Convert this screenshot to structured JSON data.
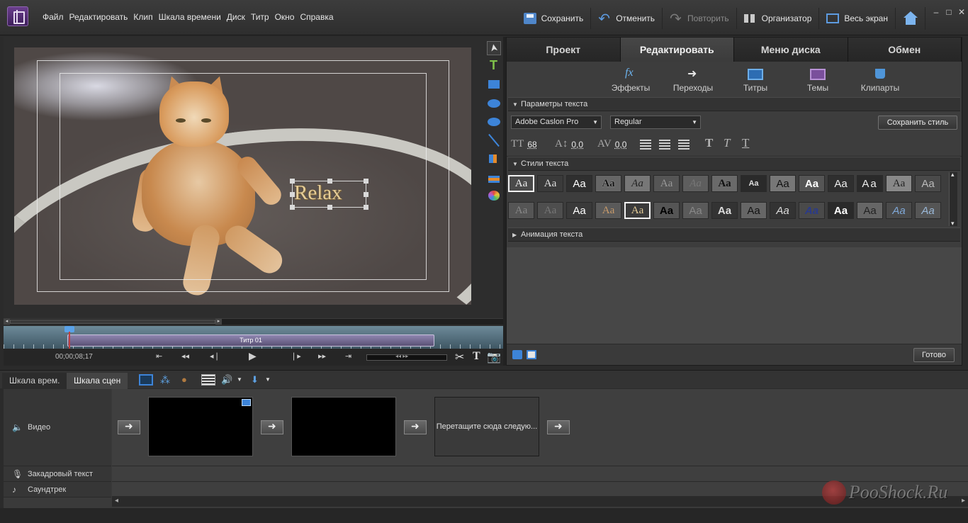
{
  "menu": [
    "Файл",
    "Редактировать",
    "Клип",
    "Шкала времени",
    "Диск",
    "Титр",
    "Окно",
    "Справка"
  ],
  "toolbar": {
    "save": "Сохранить",
    "undo": "Отменить",
    "redo": "Повторить",
    "organizer": "Организатор",
    "fullscreen": "Весь экран"
  },
  "window_controls": [
    "–",
    "□",
    "✕"
  ],
  "monitor": {
    "title_text": "Relax",
    "clip_label": "Титр 01",
    "timecode": "00;00;08;17"
  },
  "panel": {
    "tabs": [
      "Проект",
      "Редактировать",
      "Меню диска",
      "Обмен"
    ],
    "active_tab": "Редактировать",
    "sub_tabs": [
      "Эффекты",
      "Переходы",
      "Титры",
      "Темы",
      "Клипарты"
    ],
    "sections": {
      "text_params": "Параметры текста",
      "text_styles": "Стили текста",
      "text_animation": "Анимация текста"
    },
    "font_family": "Adobe Caslon Pro",
    "font_style": "Regular",
    "save_style": "Сохранить стиль",
    "font_size": "68",
    "leading": "0,0",
    "kerning": "0,0",
    "style_sample": "Aa",
    "done": "Готово"
  },
  "timeline": {
    "tabs": [
      "Шкала врем.",
      "Шкала сцен"
    ],
    "active_tab": "Шкала сцен",
    "tracks": {
      "video": "Видео",
      "narration": "Закадровый текст",
      "soundtrack": "Саундтрек"
    },
    "drop_hint": "Перетащите сюда следую..."
  },
  "watermark": "PooShock.Ru",
  "colors": {
    "accent_blue": "#3d84d8",
    "title_gold": "#e5cd98",
    "clip_purple": "#8f86b1"
  }
}
